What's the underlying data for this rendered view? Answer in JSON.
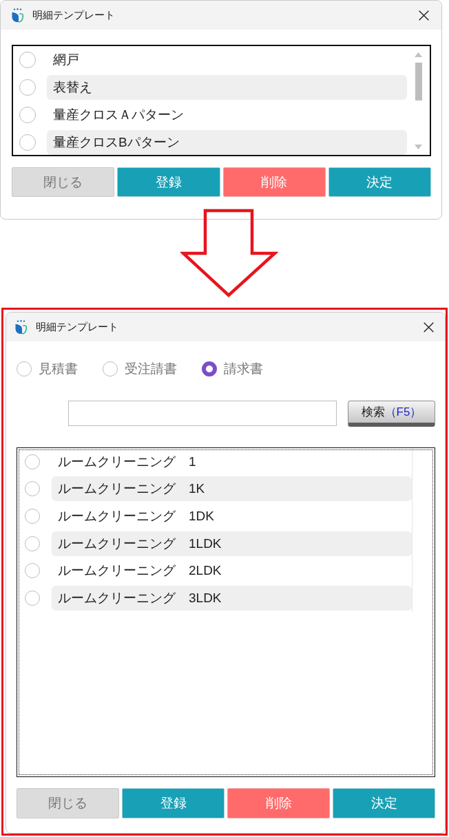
{
  "windows": [
    {
      "title": "明細テンプレート",
      "highlighted": false,
      "list": {
        "focused": false,
        "scrollbar": true,
        "items": [
          {
            "label": "網戸",
            "selected": false
          },
          {
            "label": "表替え",
            "selected": false
          },
          {
            "label": "量産クロスＡパターン",
            "selected": false
          },
          {
            "label": "量産クロスBパターン",
            "selected": false
          }
        ]
      },
      "buttons": [
        {
          "label": "閉じる",
          "kind": "close"
        },
        {
          "label": "登録",
          "kind": "register"
        },
        {
          "label": "削除",
          "kind": "delete"
        },
        {
          "label": "決定",
          "kind": "confirm"
        }
      ]
    },
    {
      "title": "明細テンプレート",
      "highlighted": true,
      "doc_types": [
        {
          "label": "見積書",
          "selected": false
        },
        {
          "label": "受注請書",
          "selected": false
        },
        {
          "label": "請求書",
          "selected": true
        }
      ],
      "search": {
        "button": {
          "label": "検索",
          "shortcut": "（F5）"
        }
      },
      "list": {
        "focused": true,
        "scrollbar": false,
        "items": [
          {
            "label": "ルームクリーニング　1",
            "selected": false
          },
          {
            "label": "ルームクリーニング　1K",
            "selected": false
          },
          {
            "label": "ルームクリーニング　1DK",
            "selected": false
          },
          {
            "label": "ルームクリーニング　1LDK",
            "selected": false
          },
          {
            "label": "ルームクリーニング　2LDK",
            "selected": false
          },
          {
            "label": "ルームクリーニング　3LDK",
            "selected": false
          }
        ]
      },
      "buttons": [
        {
          "label": "閉じる",
          "kind": "close"
        },
        {
          "label": "登録",
          "kind": "register"
        },
        {
          "label": "削除",
          "kind": "delete"
        },
        {
          "label": "決定",
          "kind": "confirm"
        }
      ]
    }
  ]
}
